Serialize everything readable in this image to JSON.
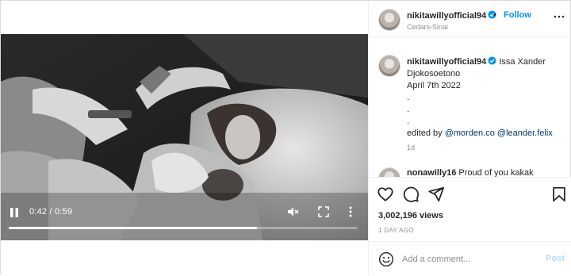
{
  "post": {
    "username": "nikitawillyofficial94",
    "follow_label": "Follow",
    "dot": "•",
    "location": "Cedars-Sinai"
  },
  "video": {
    "time": "0:42 / 0:59",
    "progress": 0.712
  },
  "caption": {
    "username": "nikitawillyofficial94",
    "line1": "Issa Xander",
    "line2": "Djokosoetono",
    "line3": "April 7th 2022",
    "line4": ".",
    "line5": ".",
    "line6": ".",
    "edited_prefix": "edited by ",
    "mention1": "@morden.co",
    "mention2": "@leander.felix",
    "age": "1d"
  },
  "comment": {
    "username": "nonawilly16",
    "text": "Proud of you kakak"
  },
  "stats": {
    "views": "3,002,196 views",
    "time_ago": "1 DAY AGO"
  },
  "add_comment": {
    "placeholder": "Add a comment...",
    "post_label": "Post"
  },
  "colors": {
    "accent": "#0095f6",
    "mention": "#00376b",
    "muted": "#8e8e8e",
    "post_disabled": "#b2dffc"
  },
  "icons": {
    "verified": "verified-badge-icon",
    "more": "more-horizontal-icon",
    "play_pause": "pause-icon",
    "mute": "speaker-muted-icon",
    "fullscreen": "fullscreen-icon",
    "video_more": "more-vertical-icon",
    "like": "heart-icon",
    "comment": "comment-bubble-icon",
    "share": "paper-plane-icon",
    "save": "bookmark-icon",
    "emoji": "smiley-icon"
  }
}
